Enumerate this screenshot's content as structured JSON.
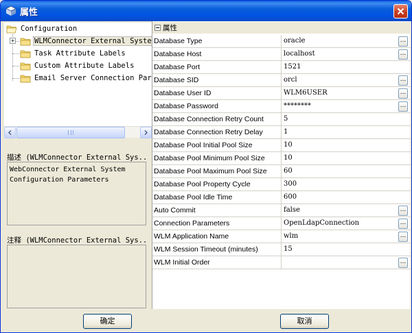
{
  "window": {
    "title": "属性"
  },
  "tree": {
    "root": "Configuration",
    "items": [
      {
        "label": "WLMConnector External System Configuration Parameters",
        "selected": true,
        "expandable": true
      },
      {
        "label": "Task Attribute Labels"
      },
      {
        "label": "Custom Attribute Labels"
      },
      {
        "label": "Email Server Connection Parameters"
      }
    ]
  },
  "description": {
    "label": "描述 (WLMConnector External Sys...",
    "text_line1": "WebConnector External System",
    "text_line2": "Configuration Parameters"
  },
  "comment": {
    "label": "注释 (WLMConnector External Sys...",
    "text": ""
  },
  "properties": {
    "category": "属性",
    "rows": [
      {
        "name": "Database Type",
        "value": "oracle",
        "has_button": true
      },
      {
        "name": "Database Host",
        "value": "localhost",
        "has_button": true
      },
      {
        "name": "Database Port",
        "value": "1521",
        "has_button": false
      },
      {
        "name": "Database SID",
        "value": "orcl",
        "has_button": true
      },
      {
        "name": "Database User ID",
        "value": "WLM6USER",
        "has_button": true
      },
      {
        "name": "Database Password",
        "value": "********",
        "has_button": true
      },
      {
        "name": "Database Connection Retry Count",
        "value": "5",
        "has_button": false
      },
      {
        "name": "Database Connection Retry Delay",
        "value": "1",
        "has_button": false
      },
      {
        "name": "Database Pool Initial Pool Size",
        "value": "10",
        "has_button": false
      },
      {
        "name": "Database Pool Minimum Pool Size",
        "value": "10",
        "has_button": false
      },
      {
        "name": "Database Pool Maximum Pool Size",
        "value": "60",
        "has_button": false
      },
      {
        "name": "Database Pool Property Cycle",
        "value": "300",
        "has_button": false
      },
      {
        "name": "Database Pool Idle Time",
        "value": "600",
        "has_button": false
      },
      {
        "name": "Auto Commit",
        "value": "false",
        "has_button": true
      },
      {
        "name": "Connection Parameters",
        "value": "OpenLdapConnection",
        "has_button": true
      },
      {
        "name": "WLM Application Name",
        "value": "wlm",
        "has_button": true
      },
      {
        "name": "WLM Session Timeout (minutes)",
        "value": "15",
        "has_button": false
      },
      {
        "name": "WLM Initial Order",
        "value": "",
        "has_button": true
      }
    ],
    "button_label": "..."
  },
  "buttons": {
    "ok": "确定",
    "cancel": "取消"
  },
  "colors": {
    "titlebar": "#0054e3",
    "close": "#c4391d",
    "panel": "#ece9d8",
    "folder": "#f5d76e"
  }
}
